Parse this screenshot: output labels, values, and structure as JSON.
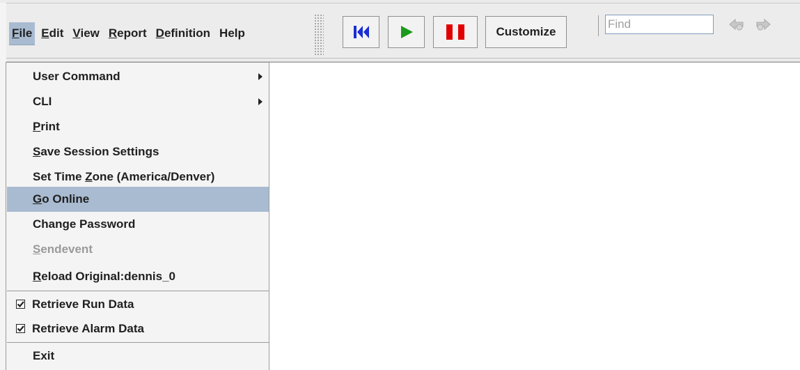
{
  "menubar": {
    "menus": [
      {
        "pre": "",
        "mn": "F",
        "post": "ile"
      },
      {
        "pre": "",
        "mn": "E",
        "post": "dit"
      },
      {
        "pre": "",
        "mn": "V",
        "post": "iew"
      },
      {
        "pre": "",
        "mn": "R",
        "post": "eport"
      },
      {
        "pre": "",
        "mn": "D",
        "post": "efinition"
      },
      {
        "pre": "Help",
        "mn": "",
        "post": ""
      }
    ]
  },
  "toolbar": {
    "customize_label": "Customize",
    "find_placeholder": "Find",
    "colors": {
      "rewind": "#1a2fd0",
      "play": "#1b9a1b",
      "pause": "#e00000"
    }
  },
  "file_menu": {
    "items": {
      "user_command": "User Command",
      "cli": "CLI",
      "print": {
        "mn": "P",
        "post": "rint"
      },
      "save_session": {
        "mn": "S",
        "post": "ave Session Settings"
      },
      "set_time_zone": {
        "pre": "Set Time ",
        "mn": "Z",
        "post": "one (America/Denver)"
      },
      "go_online": {
        "mn": "G",
        "post": "o Online"
      },
      "change_password": "Change Password",
      "sendevent": {
        "mn": "S",
        "post": "endevent"
      },
      "reload_original": {
        "mn": "R",
        "post": "eload Original:dennis_0"
      },
      "retrieve_run_data": "Retrieve Run Data",
      "retrieve_alarm_data": "Retrieve Alarm Data",
      "exit": "Exit"
    }
  }
}
